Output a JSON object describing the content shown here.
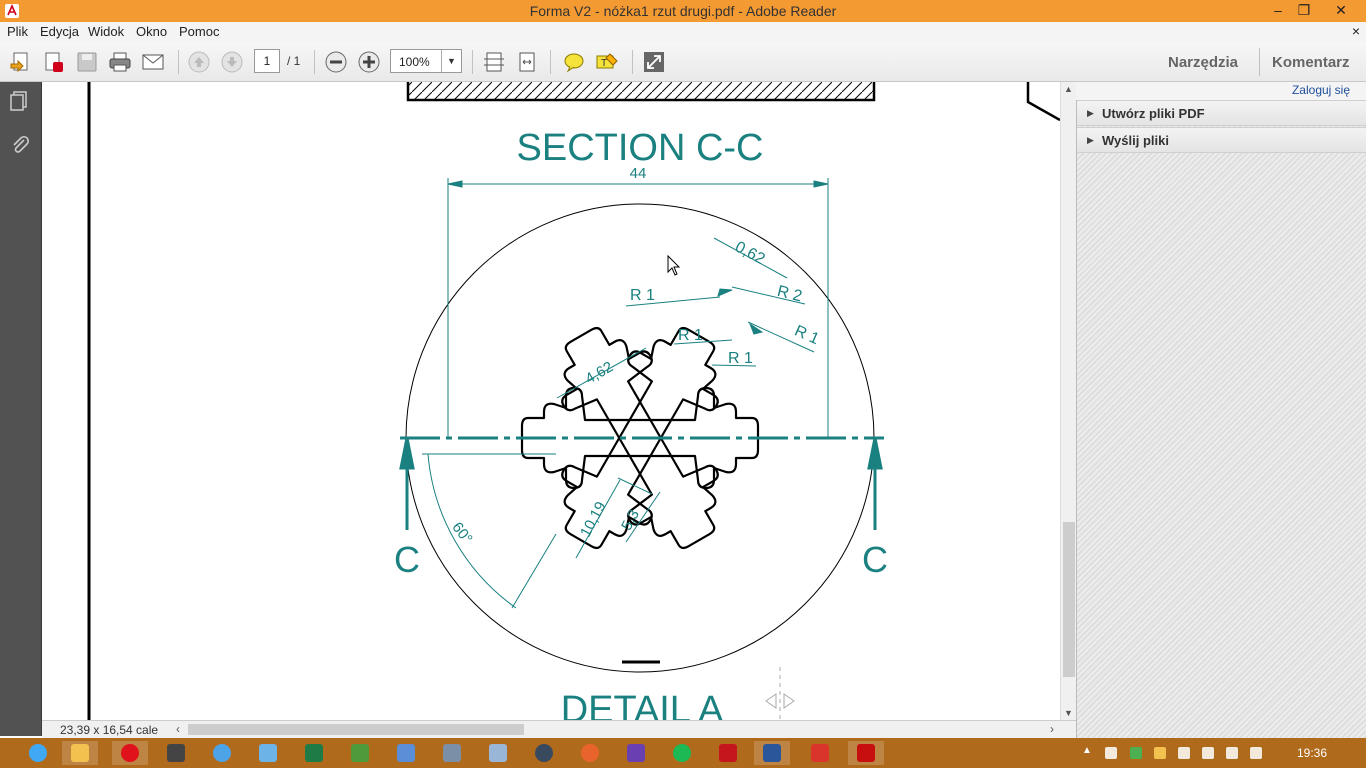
{
  "window": {
    "title": "Forma V2 - nóżka1 rzut drugi.pdf - Adobe Reader",
    "minimize": "–",
    "restore": "❐",
    "close": "✕"
  },
  "menu": {
    "items": [
      "Plik",
      "Edycja",
      "Widok",
      "Okno",
      "Pomoc"
    ],
    "close_doc": "×"
  },
  "toolbar": {
    "page_current": "1",
    "page_total": "/ 1",
    "zoom": "100%",
    "tools_label": "Narzędzia",
    "comment_label": "Komentarz"
  },
  "right_pane": {
    "login": "Zaloguj się",
    "items": [
      "Utwórz pliki PDF",
      "Wyślij pliki"
    ]
  },
  "status": {
    "doc_size": "23,39 x 16,54 cale"
  },
  "drawing": {
    "section_title": "SECTION C-C",
    "detail_title": "DETAIL A",
    "dimensions": [
      "44",
      "0,62",
      "R 2",
      "R 1",
      "R 1",
      "R 1",
      "R 1",
      "4,62",
      "10,19",
      "5,3",
      "60°"
    ],
    "section_markers": [
      "C",
      "C"
    ]
  },
  "taskbar": {
    "clock": "19:36"
  },
  "colors": {
    "titlebar": "#f39a33",
    "taskbar": "#b06a1c",
    "dimension_teal": "#1a8080"
  }
}
